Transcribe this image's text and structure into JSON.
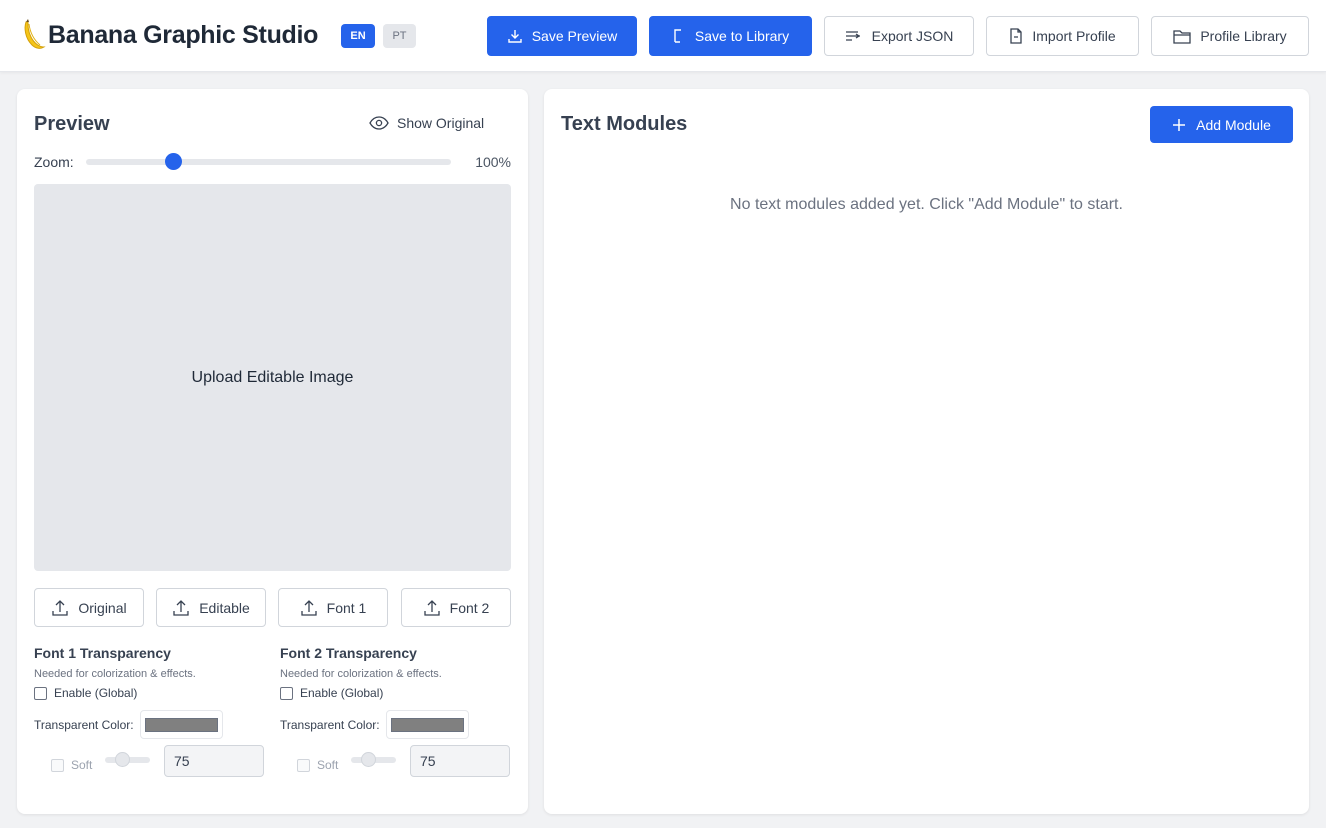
{
  "header": {
    "logo_icon": "banana-icon",
    "title": "Banana Graphic Studio",
    "languages": [
      {
        "code": "EN",
        "active": true
      },
      {
        "code": "PT",
        "active": false
      }
    ],
    "buttons": {
      "save_preview": "Save Preview",
      "save_library": "Save to Library",
      "export_json": "Export JSON",
      "import_profile": "Import Profile",
      "profile_library": "Profile Library"
    }
  },
  "preview": {
    "title": "Preview",
    "show_original": "Show Original",
    "zoom_label": "Zoom:",
    "zoom_value": "100%",
    "zoom_slider_fraction": 0.24,
    "upload_area_text": "Upload Editable Image",
    "upload_buttons": [
      "Original",
      "Editable",
      "Font 1",
      "Font 2"
    ]
  },
  "transparency": [
    {
      "title": "Font 1 Transparency",
      "hint": "Needed for colorization & effects.",
      "enable_label": "Enable (Global)",
      "enabled": false,
      "color_label": "Transparent Color:",
      "color": "#808080",
      "soft_label": "Soft",
      "tolerance": "75"
    },
    {
      "title": "Font 2 Transparency",
      "hint": "Needed for colorization & effects.",
      "enable_label": "Enable (Global)",
      "enabled": false,
      "color_label": "Transparent Color:",
      "color": "#808080",
      "soft_label": "Soft",
      "tolerance": "75"
    }
  ],
  "text_modules": {
    "title": "Text Modules",
    "add_button": "Add Module",
    "empty_message": "No text modules added yet. Click \"Add Module\" to start."
  },
  "colors": {
    "accent": "#2563eb",
    "page_background": "#f1f2f4",
    "panel_background": "#ffffff",
    "upload_area": "#e5e7eb"
  }
}
